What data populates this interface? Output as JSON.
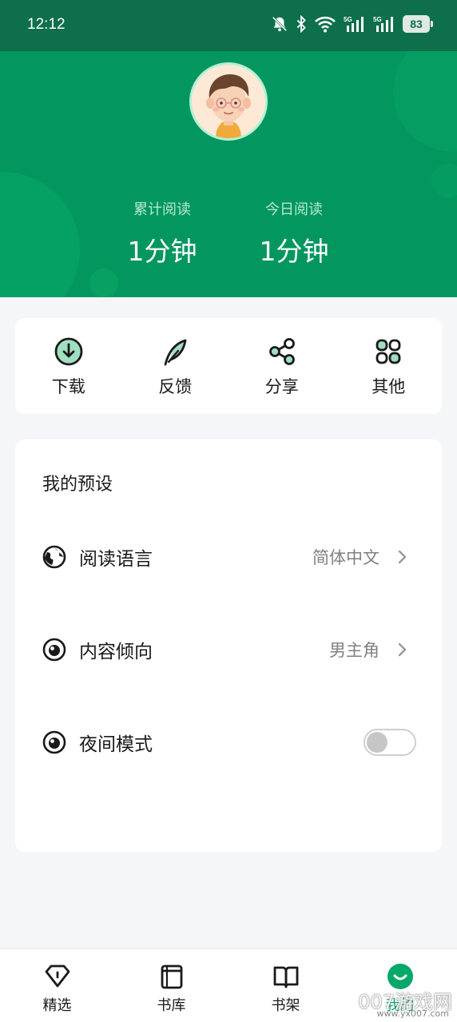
{
  "status": {
    "time": "12:12",
    "battery": "83",
    "icons": [
      "mute-bell-icon",
      "bluetooth-icon",
      "wifi-icon",
      "signal-5g-icon",
      "signal-5g-icon",
      "battery-icon"
    ]
  },
  "profile": {
    "avatar": "avatar-boy-icon",
    "stats": [
      {
        "label": "累计阅读",
        "value": "1分钟"
      },
      {
        "label": "今日阅读",
        "value": "1分钟"
      }
    ]
  },
  "quick_actions": [
    {
      "label": "下载",
      "icon": "download-icon"
    },
    {
      "label": "反馈",
      "icon": "feather-icon"
    },
    {
      "label": "分享",
      "icon": "share-icon"
    },
    {
      "label": "其他",
      "icon": "grid-icon"
    }
  ],
  "presets": {
    "title": "我的预设",
    "items": [
      {
        "label": "阅读语言",
        "value": "简体中文",
        "icon": "globe-icon"
      },
      {
        "label": "内容倾向",
        "value": "男主角",
        "icon": "eye-icon"
      },
      {
        "label": "夜间模式",
        "toggle_on": false,
        "icon": "eye-icon"
      }
    ]
  },
  "bottom_nav": [
    {
      "label": "精选",
      "icon": "diamond-icon"
    },
    {
      "label": "书库",
      "icon": "library-icon"
    },
    {
      "label": "书架",
      "icon": "book-open-icon"
    },
    {
      "label": "我的",
      "icon": "smile-icon",
      "active": true
    }
  ],
  "watermark": {
    "text": "007游戏网",
    "url": "www.yx007.com"
  },
  "colors": {
    "header": "#03975f",
    "accent": "#05a86b",
    "statusbar": "#0e6f4b"
  }
}
